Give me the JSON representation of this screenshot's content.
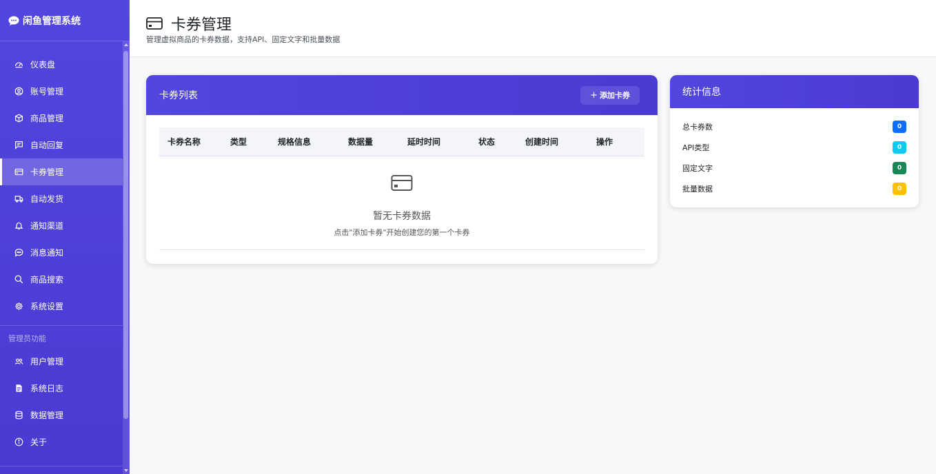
{
  "app": {
    "brand": "闲鱼管理系统"
  },
  "sidebar": {
    "items": [
      {
        "label": "仪表盘",
        "icon": "dashboard-icon"
      },
      {
        "label": "账号管理",
        "icon": "user-circle-icon"
      },
      {
        "label": "商品管理",
        "icon": "box-icon"
      },
      {
        "label": "自动回复",
        "icon": "chat-lines-icon"
      },
      {
        "label": "卡券管理",
        "icon": "card-icon",
        "active": true
      },
      {
        "label": "自动发货",
        "icon": "truck-icon"
      },
      {
        "label": "通知渠道",
        "icon": "bell-icon"
      },
      {
        "label": "消息通知",
        "icon": "chat-dots-icon"
      },
      {
        "label": "商品搜索",
        "icon": "search-icon"
      },
      {
        "label": "系统设置",
        "icon": "gear-icon"
      }
    ],
    "admin_section": "管理员功能",
    "admin_items": [
      {
        "label": "用户管理",
        "icon": "users-icon"
      },
      {
        "label": "系统日志",
        "icon": "log-icon"
      },
      {
        "label": "数据管理",
        "icon": "database-icon"
      },
      {
        "label": "关于",
        "icon": "info-icon"
      }
    ]
  },
  "header": {
    "title": "卡券管理",
    "subtitle": "管理虚拟商品的卡券数据，支持API、固定文字和批量数据"
  },
  "card_list": {
    "title": "卡券列表",
    "add_button": "添加卡券",
    "columns": [
      "卡券名称",
      "类型",
      "规格信息",
      "数据量",
      "延时时间",
      "状态",
      "创建时间",
      "操作"
    ],
    "empty_title": "暂无卡券数据",
    "empty_desc": "点击\"添加卡券\"开始创建您的第一个卡券"
  },
  "stats": {
    "title": "统计信息",
    "rows": [
      {
        "label": "总卡券数",
        "value": "0",
        "color": "#0d6efd"
      },
      {
        "label": "API类型",
        "value": "0",
        "color": "#0dcaf0"
      },
      {
        "label": "固定文字",
        "value": "0",
        "color": "#198754"
      },
      {
        "label": "批量数据",
        "value": "0",
        "color": "#ffc107"
      }
    ]
  }
}
